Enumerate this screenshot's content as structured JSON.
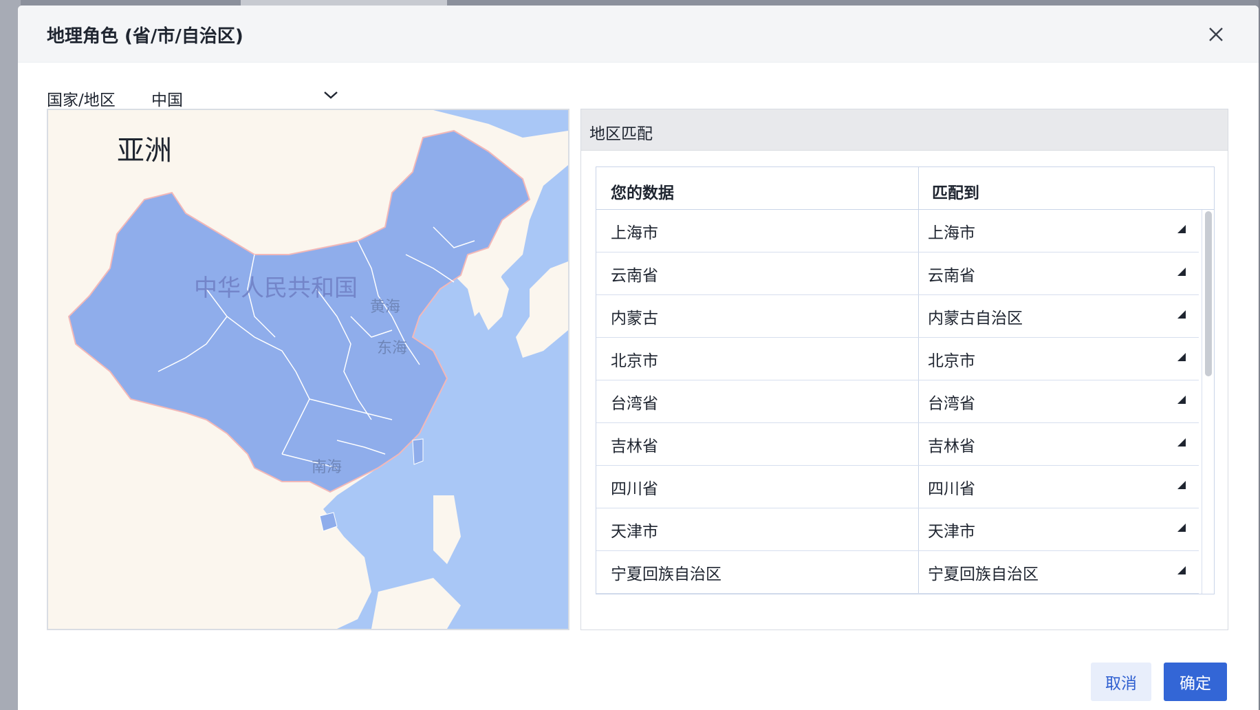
{
  "dialog": {
    "title": "地理角色 (省/市/自治区)",
    "close_icon": "close-icon"
  },
  "country": {
    "label": "国家/地区",
    "value": "中国"
  },
  "map": {
    "continent_label": "亚洲",
    "country_name": "中华人民共和国",
    "sea_labels": [
      "黄海",
      "东海",
      "南海"
    ],
    "colors": {
      "sea": "#a9c7f6",
      "land": "#fbf6ee",
      "highlight": "#8fadeb",
      "border": "#ffffff"
    }
  },
  "match": {
    "title": "地区匹配",
    "columns": [
      "您的数据",
      "匹配到"
    ],
    "rows": [
      {
        "source": "上海市",
        "target": "上海市"
      },
      {
        "source": "云南省",
        "target": "云南省"
      },
      {
        "source": "内蒙古",
        "target": "内蒙古自治区"
      },
      {
        "source": "北京市",
        "target": "北京市"
      },
      {
        "source": "台湾省",
        "target": "台湾省"
      },
      {
        "source": "吉林省",
        "target": "吉林省"
      },
      {
        "source": "四川省",
        "target": "四川省"
      },
      {
        "source": "天津市",
        "target": "天津市"
      },
      {
        "source": "宁夏回族自治区",
        "target": "宁夏回族自治区"
      }
    ]
  },
  "buttons": {
    "cancel": "取消",
    "ok": "确定"
  },
  "accent": "#3366d6"
}
